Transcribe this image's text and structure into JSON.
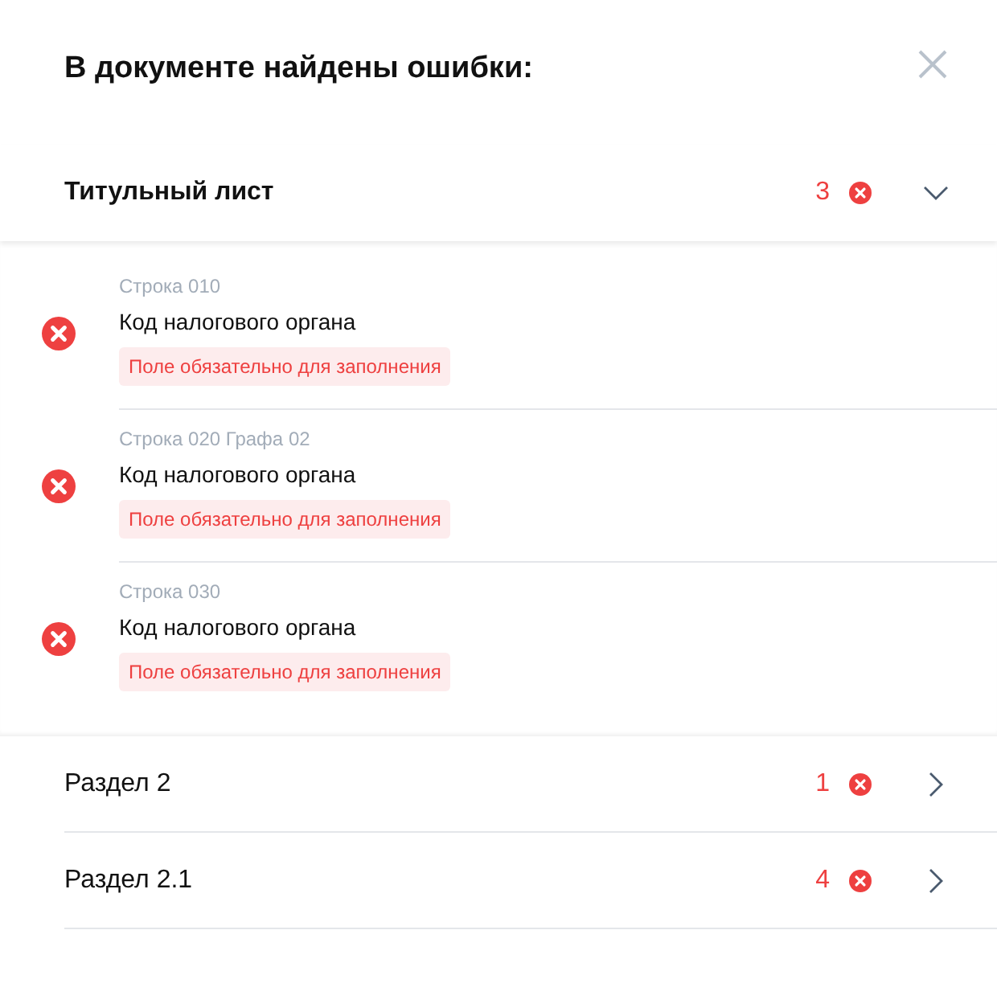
{
  "dialog": {
    "title": "В документе найдены ошибки:"
  },
  "sections": [
    {
      "title": "Титульный лист",
      "count": "3",
      "expanded": true,
      "errors": [
        {
          "location": "Строка 010",
          "field": "Код налогового органа",
          "message": "Поле обязательно для заполнения"
        },
        {
          "location": "Строка 020 Графа 02",
          "field": "Код налогового органа",
          "message": "Поле обязательно для заполнения"
        },
        {
          "location": "Строка 030",
          "field": "Код налогового органа",
          "message": "Поле обязательно для заполнения"
        }
      ]
    },
    {
      "title": "Раздел 2",
      "count": "1",
      "expanded": false
    },
    {
      "title": "Раздел 2.1",
      "count": "4",
      "expanded": false
    }
  ]
}
